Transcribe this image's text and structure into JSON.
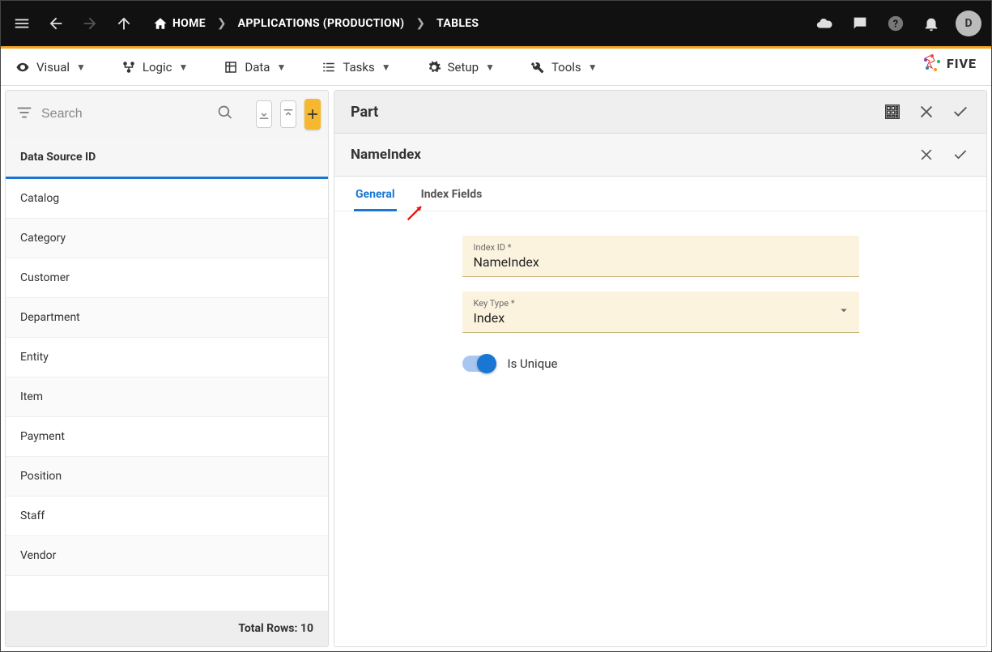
{
  "topbar": {
    "breadcrumbs": [
      "HOME",
      "APPLICATIONS (PRODUCTION)",
      "TABLES"
    ],
    "avatar_initial": "D"
  },
  "menubar": {
    "items": [
      "Visual",
      "Logic",
      "Data",
      "Tasks",
      "Setup",
      "Tools"
    ],
    "brand": "FIVE"
  },
  "left_panel": {
    "search_placeholder": "Search",
    "header": "Data Source ID",
    "rows": [
      "Catalog",
      "Category",
      "Customer",
      "Department",
      "Entity",
      "Item",
      "Payment",
      "Position",
      "Staff",
      "Vendor"
    ],
    "footer": "Total Rows: 10"
  },
  "right_panel": {
    "title": "Part",
    "subtitle": "NameIndex",
    "tabs": [
      {
        "label": "General",
        "active": true
      },
      {
        "label": "Index Fields",
        "active": false
      }
    ],
    "fields": {
      "index_id": {
        "label": "Index ID *",
        "value": "NameIndex"
      },
      "key_type": {
        "label": "Key Type *",
        "value": "Index"
      }
    },
    "toggle": {
      "label": "Is Unique",
      "on": true
    }
  }
}
